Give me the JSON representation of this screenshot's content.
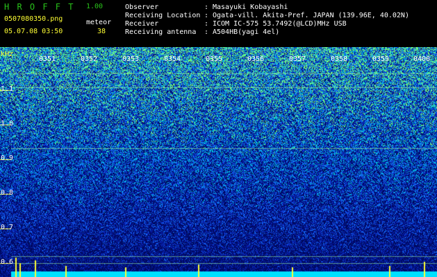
{
  "header": {
    "app_title": "H R O F F T",
    "version": "1.00",
    "filename": "0507080350.png",
    "datetime": "05.07.08 03:50",
    "meteor_label": "meteor",
    "meteor_count": "38"
  },
  "station": {
    "rows": [
      {
        "label": "Observer",
        "value": "Masayuki Kobayashi"
      },
      {
        "label": "Receiving Location",
        "value": "Ogata-vill. Akita-Pref. JAPAN (139.96E, 40.02N)"
      },
      {
        "label": "Receiver",
        "value": "ICOM IC-575 53.7492(@LCD)MHz USB"
      },
      {
        "label": "Receiving antenna",
        "value": "A504HB(yagi 4el)"
      }
    ],
    "separator": ":"
  },
  "spectrogram": {
    "y_unit": "kHz",
    "y_ticks": [
      "1.1",
      "1.0",
      "0.9",
      "0.8",
      "0.7",
      "0.6"
    ],
    "time_ticks": [
      "0351",
      "0352",
      "0353",
      "0354",
      "0355",
      "0356",
      "0357",
      "0358",
      "0359",
      "0400"
    ],
    "colors": {
      "low": "#000066",
      "mid": "#1f5fff",
      "high": "#00ffcc",
      "peak": "#ffff33",
      "baseline": "#00ffff"
    }
  }
}
